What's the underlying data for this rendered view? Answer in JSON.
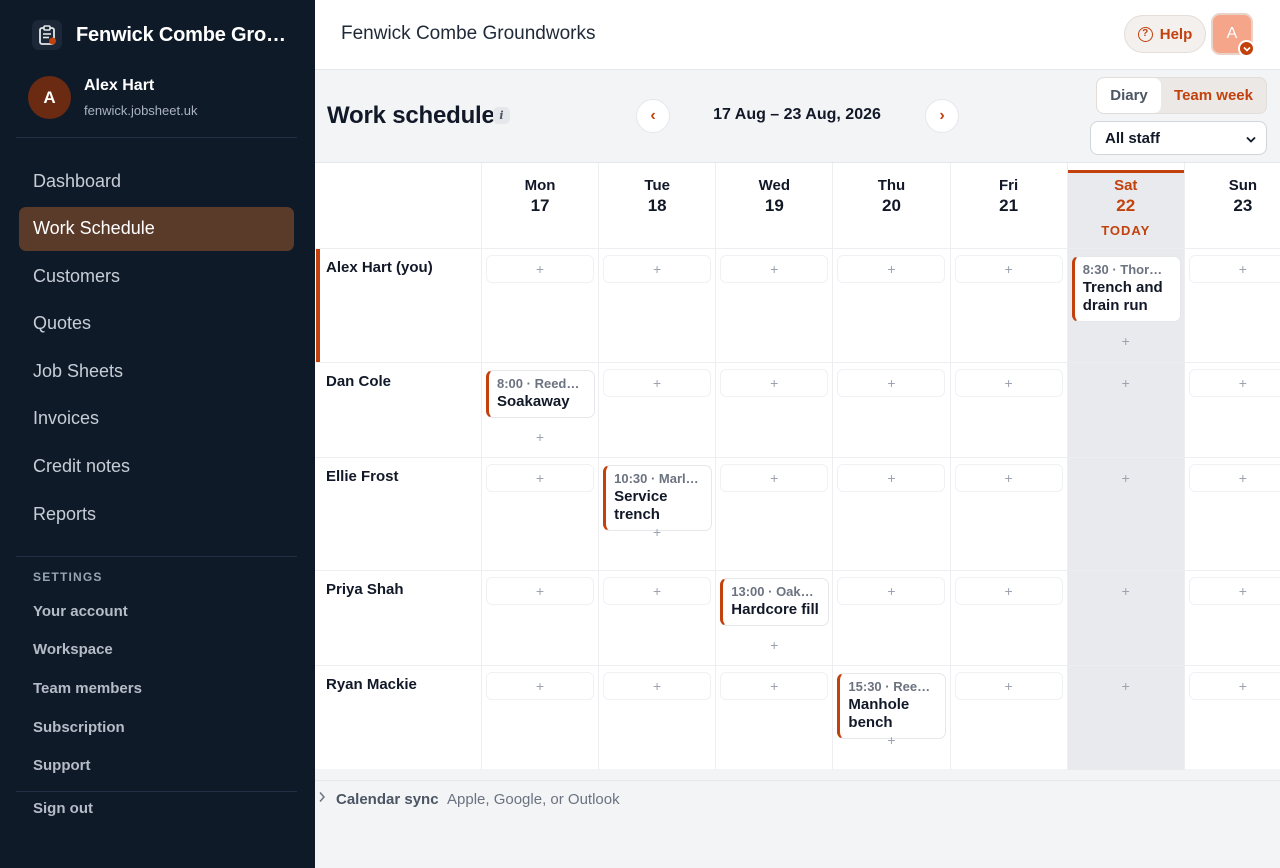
{
  "workspace": {
    "name": "Fenwick Combe Groundworks",
    "brand_short": "Fenwick Combe Grou..."
  },
  "user": {
    "initial": "A",
    "name": "Alex Hart",
    "domain": "fenwick.jobsheet.uk"
  },
  "nav": {
    "items": [
      "Dashboard",
      "Work Schedule",
      "Customers",
      "Quotes",
      "Job Sheets",
      "Invoices",
      "Credit notes",
      "Reports"
    ],
    "active": "Work Schedule"
  },
  "settings": {
    "heading": "SETTINGS",
    "items": [
      "Your account",
      "Workspace",
      "Team members",
      "Subscription",
      "Support"
    ],
    "signout": "Sign out"
  },
  "topbar": {
    "title": "Fenwick Combe Groundworks",
    "help": "Help",
    "help_glyph": "?",
    "avatar": "A"
  },
  "schedule": {
    "title": "Work schedule",
    "info_glyph": "i",
    "prev": "‹",
    "next": "›",
    "date_range": "17 Aug – 23 Aug, 2026",
    "views": {
      "diary": "Diary",
      "team": "Team week",
      "selected": "Team week"
    },
    "staff_filter": "All staff"
  },
  "days": [
    {
      "name": "Mon",
      "num": "17"
    },
    {
      "name": "Tue",
      "num": "18"
    },
    {
      "name": "Wed",
      "num": "19"
    },
    {
      "name": "Thu",
      "num": "20"
    },
    {
      "name": "Fri",
      "num": "21"
    },
    {
      "name": "Sat",
      "num": "22",
      "today": true
    },
    {
      "name": "Sun",
      "num": "23"
    }
  ],
  "today_label": "TODAY",
  "add_glyph": "+",
  "rows": [
    {
      "name": "Alex Hart (you)",
      "current_user": true
    },
    {
      "name": "Dan Cole"
    },
    {
      "name": "Ellie Frost"
    },
    {
      "name": "Priya Shah"
    },
    {
      "name": "Ryan Mackie"
    }
  ],
  "events": [
    {
      "row": 0,
      "day": 5,
      "time": "8:30 · Thor…",
      "title": "Trench and drain run"
    },
    {
      "row": 1,
      "day": 0,
      "time": "8:00 · Reed…",
      "title": "Soakaway"
    },
    {
      "row": 2,
      "day": 1,
      "time": "10:30 · Marl…",
      "title": "Service trench"
    },
    {
      "row": 3,
      "day": 2,
      "time": "13:00 · Oak…",
      "title": "Hardcore fill"
    },
    {
      "row": 4,
      "day": 3,
      "time": "15:30 · Reed…",
      "title": "Manhole bench"
    }
  ],
  "footer": {
    "label": "Calendar sync",
    "sub": "Apple, Google, or Outlook"
  },
  "colors": {
    "accent": "#c2410c",
    "sidebar": "#0f1a29",
    "active_nav": "#5a3a29"
  }
}
